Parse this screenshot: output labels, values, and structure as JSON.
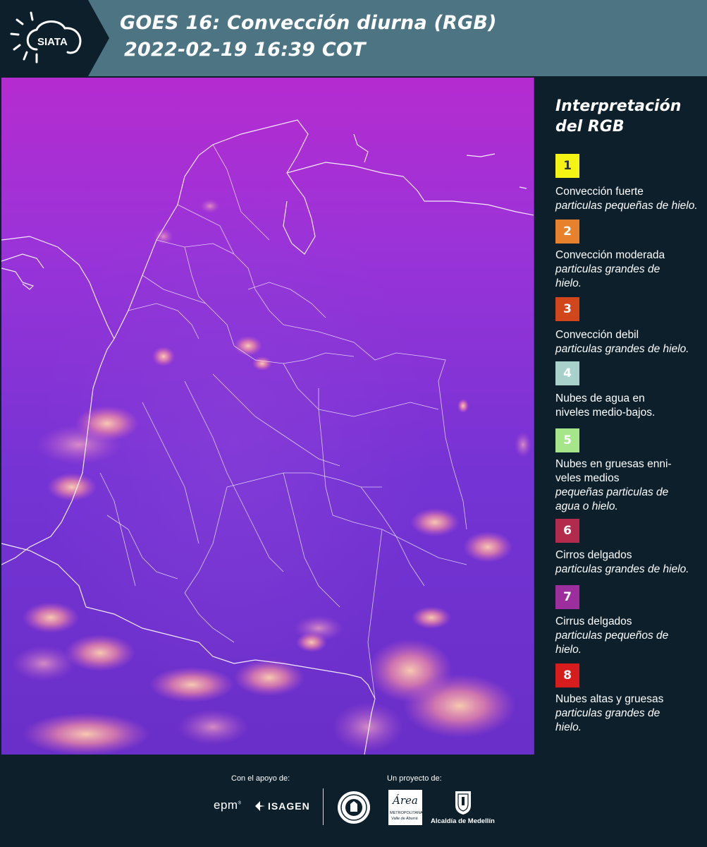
{
  "header": {
    "logo_text": "SIATA",
    "title_line1": "GOES 16: Convección diurna (RGB)",
    "title_line2": "2022-02-19 16:39 COT"
  },
  "legend": {
    "title": "Interpretación del RGB",
    "items": [
      {
        "num": "1",
        "color": "#f4f414",
        "text_color": "#333333",
        "name": "Convección fuerte",
        "detail": "particulas pequeñas de hielo."
      },
      {
        "num": "2",
        "color": "#e8812c",
        "text_color": "#ffffff",
        "name": "Convección moderada",
        "detail": "particulas grandes de hielo."
      },
      {
        "num": "3",
        "color": "#d2461c",
        "text_color": "#ffffff",
        "name": "Convección debil",
        "detail": "particulas grandes de hielo."
      },
      {
        "num": "4",
        "color": "#a9d1cc",
        "text_color": "#ffffff",
        "name": "Nubes de agua en niveles medio-bajos.",
        "detail": ""
      },
      {
        "num": "5",
        "color": "#a6e58a",
        "text_color": "#ffffff",
        "name": "Nubes en gruesas enni-veles medios",
        "detail": "pequeñas particulas de agua o hielo."
      },
      {
        "num": "6",
        "color": "#b32a4c",
        "text_color": "#ffffff",
        "name": "Cirros delgados",
        "detail": "particulas grandes de hielo."
      },
      {
        "num": "7",
        "color": "#9c2f9d",
        "text_color": "#ffffff",
        "name": "Cirrus delgados",
        "detail": "particulas pequeños de hielo."
      },
      {
        "num": "8",
        "color": "#d61c1c",
        "text_color": "#ffffff",
        "name": "Nubes altas y gruesas",
        "detail": "particulas grandes de hielo."
      }
    ]
  },
  "footer": {
    "support_label": "Con el apoyo de:",
    "project_label": "Un proyecto de:",
    "sponsor1": "epm",
    "sponsor2": "ISAGEN",
    "partner_area": "Área",
    "partner_area_sub1": "METROPOLITANA",
    "partner_area_sub2": "Valle de Aburrá",
    "partner_alcaldia": "Alcaldía de Medellín"
  },
  "colors": {
    "header_bg": "#4d7483",
    "panel_bg": "#0c1f2b",
    "map_base": "#7a2fd6"
  }
}
